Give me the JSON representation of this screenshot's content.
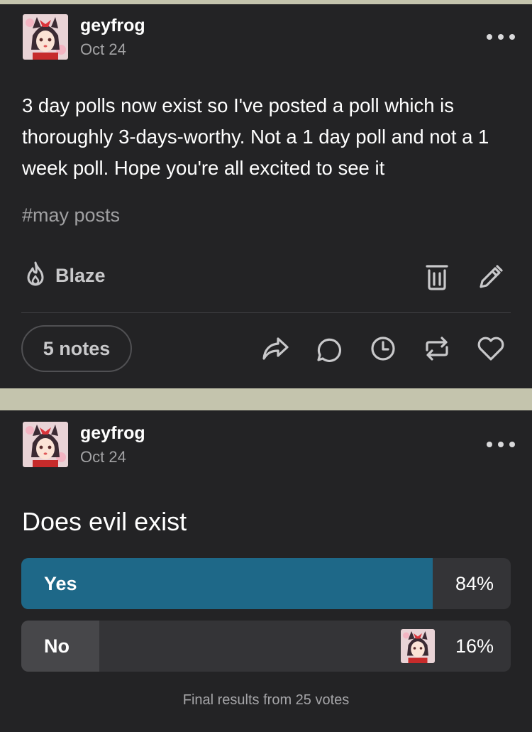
{
  "colors": {
    "page_background": "#c4c4ad",
    "post_background": "#232325",
    "poll_winner_fill": "#1e6888",
    "poll_loser_fill": "#47474a",
    "poll_track": "#343437",
    "muted_text": "#a3a3a5"
  },
  "posts": [
    {
      "author": "geyfrog",
      "date": "Oct 24",
      "avatar_icon": "anime-girl-avatar",
      "more_icon": "ellipsis-icon",
      "body": "3 day polls now exist so I've posted a poll which is thoroughly 3-days-worthy. Not a 1 day poll and not a 1 week poll. Hope you're all excited to see it",
      "tag": "#may posts",
      "blaze_label": "Blaze",
      "blaze_icon": "flame-icon",
      "owner_actions": [
        "trash-icon",
        "pencil-icon"
      ],
      "notes_label": "5 notes",
      "footer_actions": [
        "share-icon",
        "reply-icon",
        "queue-clock-icon",
        "reblog-icon",
        "heart-icon"
      ]
    },
    {
      "author": "geyfrog",
      "date": "Oct 24",
      "avatar_icon": "anime-girl-avatar",
      "more_icon": "ellipsis-icon",
      "poll": {
        "question": "Does evil exist",
        "options": [
          {
            "label": "Yes",
            "percent_text": "84%",
            "fraction": 0.84,
            "winner": true
          },
          {
            "label": "No",
            "percent_text": "16%",
            "fraction": 0.16,
            "winner": false,
            "voted_marker": "voter-avatar"
          }
        ],
        "footer": "Final results from 25 votes"
      }
    }
  ]
}
